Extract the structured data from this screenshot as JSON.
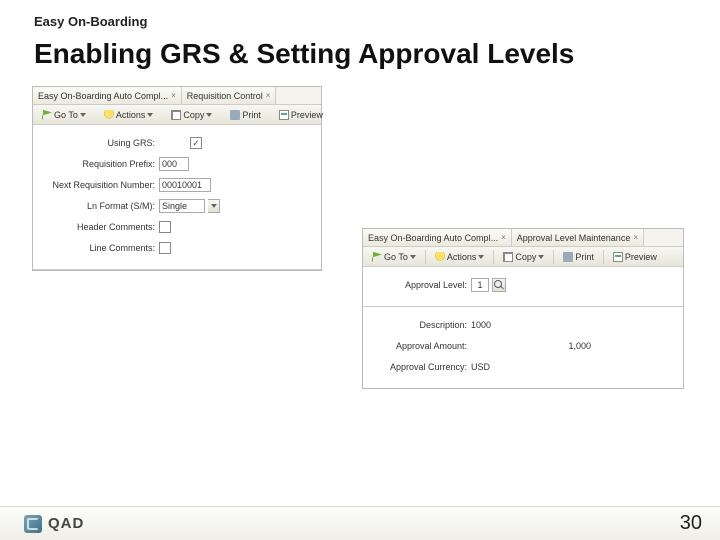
{
  "header": "Easy On-Boarding",
  "title": "Enabling GRS & Setting Approval Levels",
  "toolbar": {
    "goto": "Go To",
    "actions": "Actions",
    "copy": "Copy",
    "print": "Print",
    "preview": "Preview"
  },
  "panel1": {
    "tabs": [
      "Easy On-Boarding Auto Compl...",
      "Requisition Control"
    ],
    "fields": {
      "using_grs_label": "Using GRS:",
      "using_grs_checked": "✓",
      "req_prefix_label": "Requisition Prefix:",
      "req_prefix_value": "000",
      "next_req_label": "Next Requisition Number:",
      "next_req_value": "00010001",
      "ln_format_label": "Ln Format (S/M):",
      "ln_format_value": "Single",
      "header_comments_label": "Header Comments:",
      "line_comments_label": "Line Comments:"
    }
  },
  "panel2": {
    "tabs": [
      "Easy On-Boarding Auto Compl...",
      "Approval Level Maintenance"
    ],
    "fields": {
      "approval_level_label": "Approval Level:",
      "approval_level_value": "1",
      "description_label": "Description:",
      "description_value": "1000",
      "approval_amount_label": "Approval Amount:",
      "approval_amount_value": "1,000",
      "approval_currency_label": "Approval Currency:",
      "approval_currency_value": "USD"
    }
  },
  "footer": {
    "brand": "QAD",
    "page": "30"
  }
}
